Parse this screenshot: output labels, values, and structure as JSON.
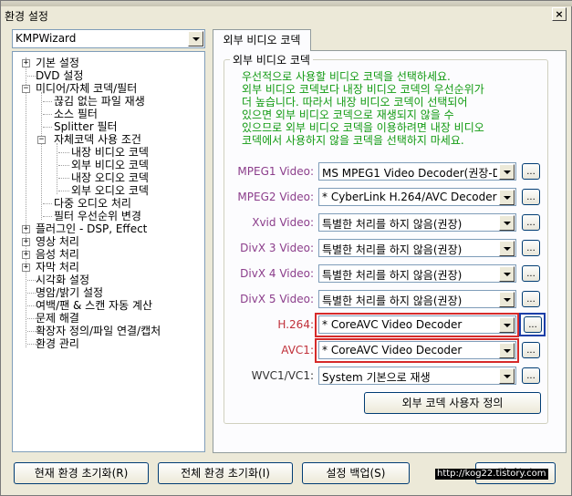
{
  "window": {
    "title": "환경 설정",
    "close_label": "×"
  },
  "profile": {
    "selected": "KMPWizard"
  },
  "tree": {
    "items": [
      {
        "label": "기본 설정",
        "expander": "+"
      },
      {
        "label": "DVD 설정"
      },
      {
        "label": "미디어/자체 코덱/필터",
        "expander": "−"
      },
      {
        "label": "끊김 없는 파일 재생"
      },
      {
        "label": "소스 필터"
      },
      {
        "label": "Splitter 필터"
      },
      {
        "label": "자체코덱 사용 조건",
        "expander": "−"
      },
      {
        "label": "내장 비디오 코덱"
      },
      {
        "label": "외부 비디오 코덱"
      },
      {
        "label": "내장 오디오 코덱"
      },
      {
        "label": "외부 오디오 코덱"
      },
      {
        "label": "다중 오디오 처리"
      },
      {
        "label": "필터 우선순위 변경"
      },
      {
        "label": "플러그인 - DSP, Effect",
        "expander": "+"
      },
      {
        "label": "영상 처리",
        "expander": "+"
      },
      {
        "label": "음성 처리",
        "expander": "+"
      },
      {
        "label": "자막 처리",
        "expander": "+"
      },
      {
        "label": "시각화 설정"
      },
      {
        "label": "명암/밝기 설정"
      },
      {
        "label": "여백/팬 & 스캔 자동 계산"
      },
      {
        "label": "문제 해결"
      },
      {
        "label": "확장자 정의/파일 연결/캡처"
      },
      {
        "label": "환경 관리"
      }
    ]
  },
  "tab": {
    "label": "외부 비디오 코덱"
  },
  "group": {
    "title": "외부 비디오 코덱"
  },
  "description": {
    "lines": [
      "우선적으로 사용할 비디오 코덱을 선택하세요.",
      "외부 비디오 코덱보다 내장 비디오 코덱의 우선순위가",
      "더 높습니다. 따라서 내장 비디오 코덱이 선택되어",
      "있으면 외부 비디오 코덱으로 재생되지 않을 수",
      "있으므로 외부 비디오 코덱을 이용하려면 내장 비디오",
      "코덱에서 사용하지 않을 코덱을 선택하지 마세요."
    ]
  },
  "codecs": [
    {
      "label": "MPEG1 Video:",
      "value": "MS MPEG1 Video Decoder(권장-D",
      "more": "..."
    },
    {
      "label": "MPEG2 Video:",
      "value": "* CyberLink H.264/AVC Decoder (",
      "more": "..."
    },
    {
      "label": "Xvid Video:",
      "value": "특별한 처리를 하지 않음(권장)",
      "more": "..."
    },
    {
      "label": "DivX 3 Video:",
      "value": "특별한 처리를 하지 않음(권장)",
      "more": "..."
    },
    {
      "label": "DivX 4 Video:",
      "value": "특별한 처리를 하지 않음(권장)",
      "more": "..."
    },
    {
      "label": "DivX 5 Video:",
      "value": "특별한 처리를 하지 않음(권장)",
      "more": "..."
    },
    {
      "label": "H.264:",
      "value": "* CoreAVC Video Decoder",
      "more": "..."
    },
    {
      "label": "AVC1:",
      "value": "* CoreAVC Video Decoder",
      "more": "..."
    },
    {
      "label": "WVC1/VC1:",
      "value": "System 기본으로 재생",
      "more": "..."
    }
  ],
  "custom_codec_button": "외부 코덱 사용자 정의",
  "footer": {
    "reset_current": "현재 환경 초기화(R)",
    "reset_all": "전체 환경 초기화(I)",
    "backup": "설정 백업(S)",
    "close": "닫기(C)"
  },
  "watermark": "http://kog22.tistory.com",
  "colors": {
    "codec_label": "#8b3d8b",
    "highlight_label": "#c0303a",
    "description_text": "#119a11",
    "highlight_box_red": "#d62a2a",
    "highlight_box_blue": "#1c3fa8"
  }
}
